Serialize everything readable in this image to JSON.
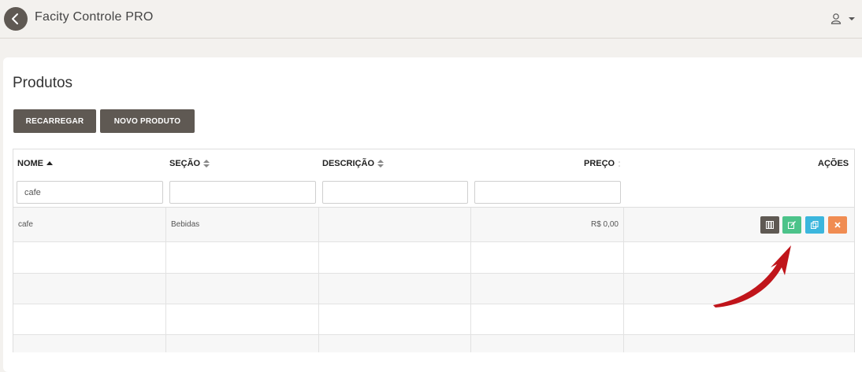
{
  "header": {
    "app_title": "Facity Controle PRO",
    "back_icon": "chevron-left-icon",
    "user_icon": "user-icon"
  },
  "page": {
    "title": "Produtos",
    "buttons": {
      "reload_label": "RECARREGAR",
      "new_label": "NOVO PRODUTO"
    }
  },
  "table": {
    "columns": [
      {
        "label": "NOME",
        "sort": "ascending"
      },
      {
        "label": "SEÇÃO",
        "sort": "none"
      },
      {
        "label": "DESCRIÇÃO",
        "sort": "none"
      },
      {
        "label": "PREÇO",
        "sort": "none"
      },
      {
        "label": "AÇÕES"
      }
    ],
    "filters": {
      "nome": "cafe",
      "secao": "",
      "descricao": "",
      "preco": ""
    },
    "rows": [
      {
        "nome": "cafe",
        "secao": "Bebidas",
        "descricao": "",
        "preco": "R$ 0,00"
      }
    ],
    "actions": [
      {
        "name": "columns-icon",
        "color": "#5f5953"
      },
      {
        "name": "edit-icon",
        "color": "#4cc38a"
      },
      {
        "name": "copy-icon",
        "color": "#3bb6dd"
      },
      {
        "name": "close-icon",
        "color": "#f08c52"
      }
    ]
  },
  "colors": {
    "brand_dark": "#5f5953",
    "arrow": "#c0151b"
  }
}
